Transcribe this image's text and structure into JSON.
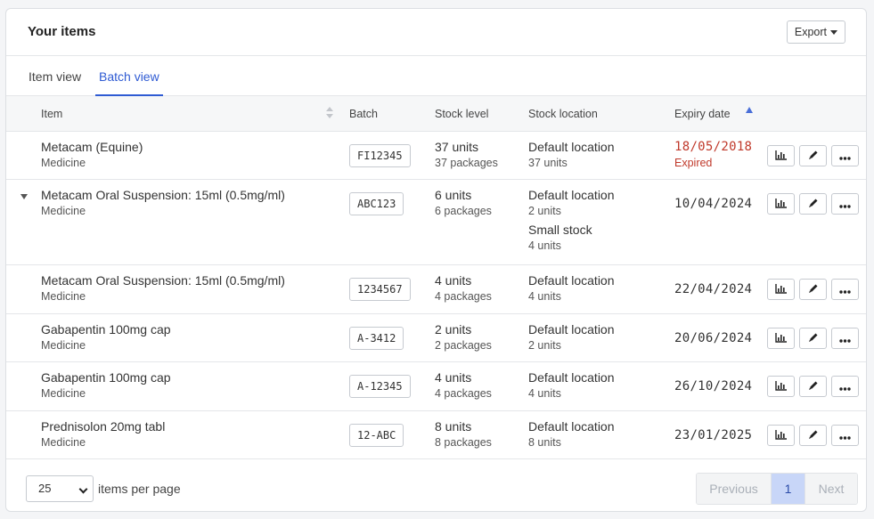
{
  "header": {
    "title": "Your items",
    "export_label": "Export"
  },
  "tabs": [
    {
      "label": "Item view",
      "active": false
    },
    {
      "label": "Batch view",
      "active": true
    }
  ],
  "columns": {
    "item": "Item",
    "batch": "Batch",
    "stock": "Stock level",
    "location": "Stock location",
    "expiry": "Expiry date"
  },
  "rows": [
    {
      "name": "Metacam (Equine)",
      "type": "Medicine",
      "batch": "FI12345",
      "units": "37 units",
      "packages": "37 packages",
      "locations": [
        {
          "name": "Default location",
          "units": "37 units"
        }
      ],
      "expiry": "18/05/2018",
      "expired_label": "Expired"
    },
    {
      "name": "Metacam Oral Suspension: 15ml (0.5mg/ml)",
      "type": "Medicine",
      "batch": "ABC123",
      "units": "6 units",
      "packages": "6 packages",
      "locations": [
        {
          "name": "Default location",
          "units": "2 units"
        },
        {
          "name": "Small stock",
          "units": "4 units"
        }
      ],
      "expiry": "10/04/2024"
    },
    {
      "name": "Metacam Oral Suspension: 15ml (0.5mg/ml)",
      "type": "Medicine",
      "batch": "1234567",
      "units": "4 units",
      "packages": "4 packages",
      "locations": [
        {
          "name": "Default location",
          "units": "4 units"
        }
      ],
      "expiry": "22/04/2024"
    },
    {
      "name": "Gabapentin 100mg cap",
      "type": "Medicine",
      "batch": "A-3412",
      "units": "2 units",
      "packages": "2 packages",
      "locations": [
        {
          "name": "Default location",
          "units": "2 units"
        }
      ],
      "expiry": "20/06/2024"
    },
    {
      "name": "Gabapentin 100mg cap",
      "type": "Medicine",
      "batch": "A-12345",
      "units": "4 units",
      "packages": "4 packages",
      "locations": [
        {
          "name": "Default location",
          "units": "4 units"
        }
      ],
      "expiry": "26/10/2024"
    },
    {
      "name": "Prednisolon 20mg tabl",
      "type": "Medicine",
      "batch": "12-ABC",
      "units": "8 units",
      "packages": "8 packages",
      "locations": [
        {
          "name": "Default location",
          "units": "8 units"
        }
      ],
      "expiry": "23/01/2025"
    }
  ],
  "icons": {
    "chart": "bar-chart-icon",
    "edit": "pencil-icon",
    "more": "more-icon",
    "expand": "caret-down-icon"
  },
  "colors": {
    "accent": "#2f5bd3",
    "expired": "#c0392b",
    "active_page": "#c8d6f8"
  },
  "footer": {
    "per_page_value": "25",
    "per_page_label": "items per page",
    "previous": "Previous",
    "current_page": "1",
    "next": "Next"
  }
}
